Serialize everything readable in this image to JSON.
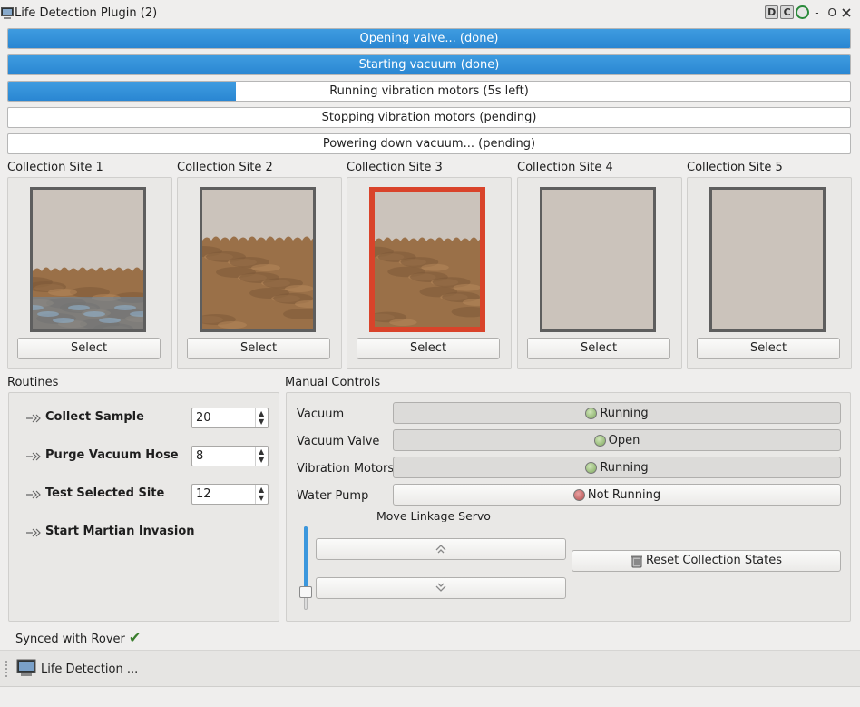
{
  "window": {
    "title": "Life Detection Plugin (2)",
    "title_buttons": [
      "D",
      "C",
      "O"
    ],
    "title_minus": "-",
    "title_o": "O"
  },
  "progress": [
    {
      "label": "Opening valve... (done)",
      "fill": 1.0
    },
    {
      "label": "Starting vacuum (done)",
      "fill": 1.0
    },
    {
      "label": "Running vibration motors (5s left)",
      "fill": 0.27
    },
    {
      "label": "Stopping vibration motors (pending)",
      "fill": 0
    },
    {
      "label": "Powering down vacuum... (pending)",
      "fill": 0
    }
  ],
  "sites": [
    {
      "label": "Collection Site 1",
      "button": "Select",
      "fill": "soil-water",
      "selected": false
    },
    {
      "label": "Collection Site 2",
      "button": "Select",
      "fill": "soil",
      "selected": false
    },
    {
      "label": "Collection Site 3",
      "button": "Select",
      "fill": "soil",
      "selected": true
    },
    {
      "label": "Collection Site 4",
      "button": "Select",
      "fill": "empty",
      "selected": false
    },
    {
      "label": "Collection Site 5",
      "button": "Select",
      "fill": "empty",
      "selected": false
    }
  ],
  "routines": {
    "title": "Routines",
    "items": [
      {
        "label": "Collect Sample",
        "value": "20"
      },
      {
        "label": "Purge Vacuum Hose",
        "value": "8"
      },
      {
        "label": "Test Selected Site",
        "value": "12"
      },
      {
        "label": "Start Martian Invasion"
      }
    ]
  },
  "manual": {
    "title": "Manual Controls",
    "rows": [
      {
        "label": "Vacuum",
        "state": "Running",
        "color": "#7fa85e"
      },
      {
        "label": "Vacuum Valve",
        "state": "Open",
        "color": "#7fa85e"
      },
      {
        "label": "Vibration Motors",
        "state": "Running",
        "color": "#7fa85e"
      },
      {
        "label": "Water Pump",
        "state": "Not Running",
        "color": "#b64e4e"
      }
    ],
    "servo_label": "Move Linkage Servo",
    "servo_level": 0.17,
    "reset_label": "Reset Collection States"
  },
  "status": {
    "text": "Synced with Rover"
  },
  "taskbar": {
    "label": "Life Detection ..."
  },
  "colors": {
    "accent": "#2a86d2",
    "selected_border": "#d9432a"
  }
}
